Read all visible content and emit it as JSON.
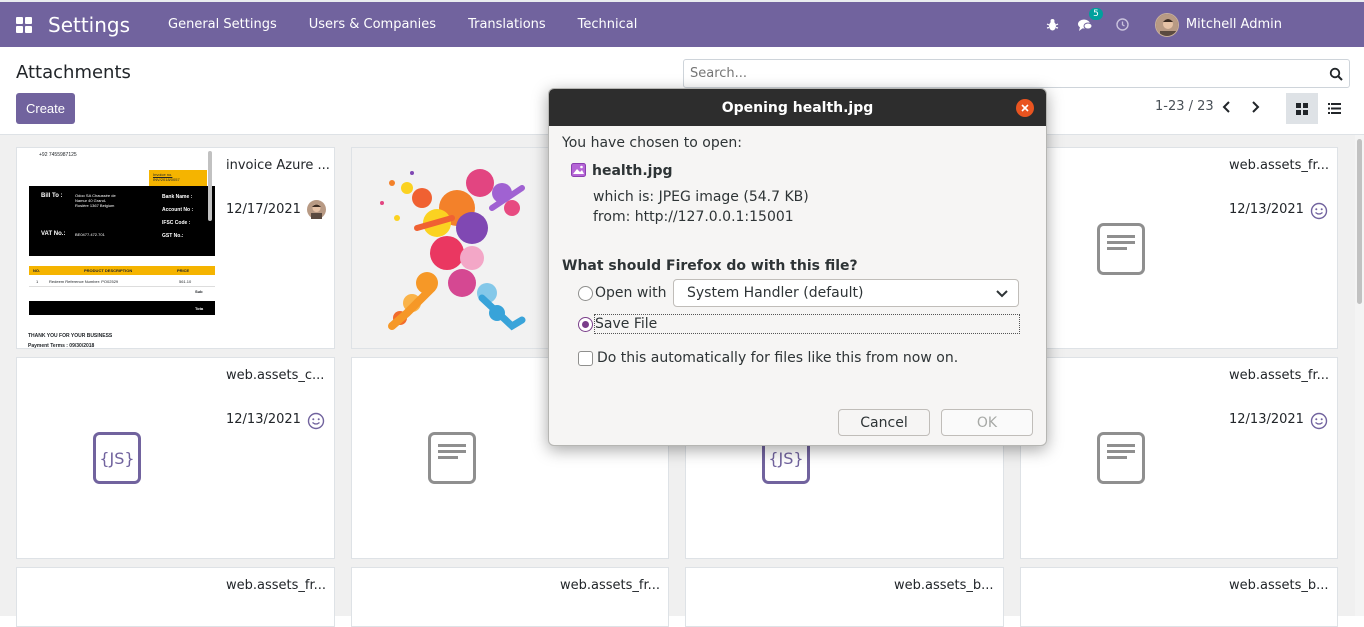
{
  "navbar": {
    "app_title": "Settings",
    "menu": [
      "General Settings",
      "Users & Companies",
      "Translations",
      "Technical"
    ],
    "messages_badge": "5",
    "user_name": "Mitchell Admin"
  },
  "control_panel": {
    "breadcrumb": "Attachments",
    "create_label": "Create",
    "search_placeholder": "Search...",
    "pager": "1-23 / 23"
  },
  "cards": [
    {
      "title": "invoice Azure ...",
      "date": "12/17/2021"
    },
    {
      "title": "",
      "date": ""
    },
    {
      "title": "web.assets_fr...",
      "date": "12/13/2021"
    },
    {
      "title": "web.assets_c...",
      "date": "12/13/2021"
    },
    {
      "title": "web.assets_fr...",
      "date": "12/13/2021"
    },
    {
      "title": "web.assets_fr...",
      "date": ""
    },
    {
      "title": "web.assets_fr...",
      "date": ""
    },
    {
      "title": "web.assets_b...",
      "date": ""
    },
    {
      "title": "web.assets_b...",
      "date": ""
    }
  ],
  "invoice_thumb": {
    "phone": "+92 7455987125",
    "invoice_no_label": "Invoice no.",
    "invoice_no": "INV/2018/0057",
    "bill_to_label": "Bill To :",
    "bill_to": "Odoo SA Chaussée de Namur 40 Grand-Rosière 1367 Belgium",
    "bank_name_label": "Bank Name :",
    "account_no_label": "Account No :",
    "ifsc_label": "IFSC Code :",
    "vat_label": "VAT No.:",
    "vat": "BE0477.472.701",
    "gst_label": "GST No.:",
    "col_no": "NO.",
    "col_desc": "PRODUCT DESCRIPTION",
    "col_price": "PRICE",
    "row_no": "1",
    "row_desc": "Redeem Reference Number: PO02529",
    "row_price": "561.10",
    "subtotal": "Sub",
    "total": "Tota",
    "thanks": "THANK YOU FOR YOUR BUSINESS",
    "payment_terms": "Payment Terms : 09/30/2018"
  },
  "dialog": {
    "title": "Opening health.jpg",
    "intro": "You have chosen to open:",
    "filename": "health.jpg",
    "which_is": "which is:  JPEG image (54.7 KB)",
    "from": "from:  http://127.0.0.1:15001",
    "question": "What should Firefox do with this file?",
    "open_with_label": "Open with",
    "handler": "System Handler (default)",
    "save_file_label": "Save File",
    "auto_label": "Do this automatically for files like this from now on.",
    "cancel_label": "Cancel",
    "ok_label": "OK",
    "selected_option": "Save File"
  },
  "colors": {
    "brand": "#71639e",
    "dialog_header": "#2d2d2d",
    "close_button": "#e95420",
    "radio_selected": "#7a3e8a"
  }
}
